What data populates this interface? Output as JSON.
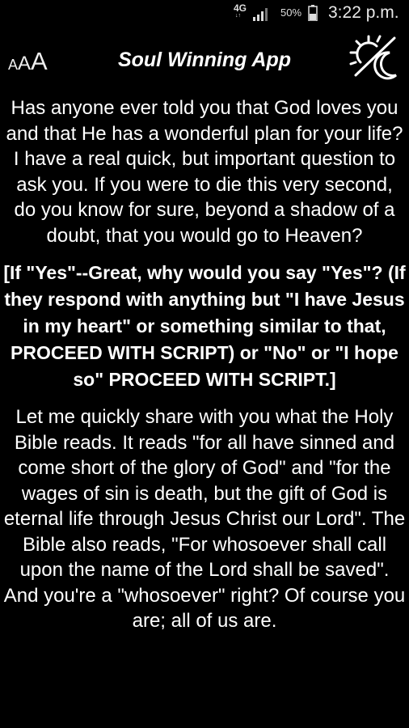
{
  "status_bar": {
    "network": "4G",
    "network_sub": "↓↑",
    "battery": "50%",
    "time": "3:22 p.m."
  },
  "header": {
    "font_size_label": [
      "A",
      "A",
      "A"
    ],
    "title": "Soul Winning App",
    "theme_toggle_icon": "sun-moon-icon"
  },
  "content": {
    "paragraphs": [
      "Has anyone ever told you that God loves you and that He has a wonderful plan for your life? I have a real quick, but important question to ask you. If you were to die this very second, do you know for sure, beyond a shadow of a doubt, that you would go to Heaven?",
      "[If \"Yes\"--Great, why would you say \"Yes\"? (If they respond with anything but \"I have Jesus in my heart\" or something similar to that, PROCEED WITH SCRIPT) or \"No\" or \"I hope so\" PROCEED WITH SCRIPT.]",
      "Let me quickly share with you what the Holy Bible reads. It reads \"for all have sinned and come short of the glory of God\" and \"for the wages of sin is death, but the gift of God is eternal life through Jesus Christ our Lord\". The Bible also reads, \"For whosoever shall call upon the name of the Lord shall be saved\". And you're a \"whosoever\" right? Of course you are; all of us are."
    ]
  },
  "colors": {
    "background": "#000000",
    "text": "#ffffff",
    "status_text": "#dddddd"
  }
}
